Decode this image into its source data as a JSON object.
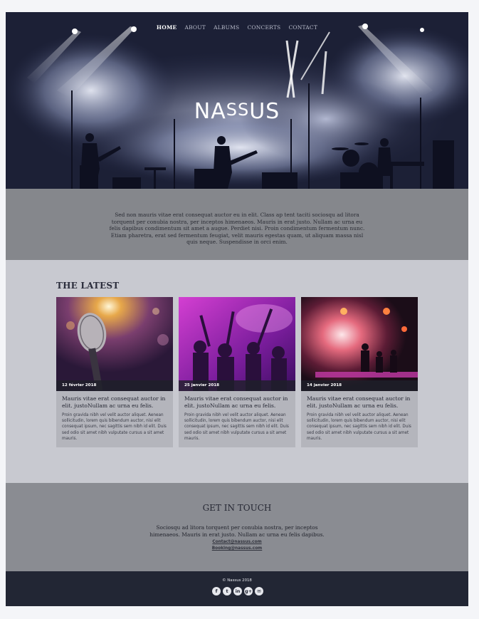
{
  "nav": {
    "items": [
      {
        "label": "HOME"
      },
      {
        "label": "ABOUT"
      },
      {
        "label": "ALBUMS"
      },
      {
        "label": "CONCERTS"
      },
      {
        "label": "CONTACT"
      }
    ]
  },
  "hero": {
    "logo_part1": "NA",
    "logo_part2": "SS",
    "logo_part3": "US",
    "text": "Sed non mauris vitae erat consequat auctor eu in elit. Class ap tent taciti sociosqu ad litora torquent per conubia nostra, per inceptos himenaeos. Mauris in erat justo. Nullam ac urna eu felis dapibus condimentum sit amet a augue. Perdiet nisi. Proin condimentum fermentum nunc. Etiam pharetra, erat sed fermentum feugiat, velit mauris egestas quam, ut aliquam massa nisl quis neque. Suspendisse in orci enim."
  },
  "latest": {
    "title": "THE LATEST",
    "cards": [
      {
        "date": "12 février 2018",
        "title": "Mauris vitae erat consequat auctor in elit. justoNullam ac urna eu felis.",
        "body": "Proin gravida nibh vel velit auctor aliquet. Aenean sollicitudin, lorem quis bibendum auctor, nisi elit consequat ipsum, nec sagittis sem nibh id elit. Duis sed odio sit amet nibh vulputate cursus a sit amet mauris."
      },
      {
        "date": "25 janvier 2018",
        "title": "Mauris vitae erat consequat auctor in elit. justoNullam ac urna eu felis.",
        "body": "Proin gravida nibh vel velit auctor aliquet. Aenean sollicitudin, lorem quis bibendum auctor, nisi elit consequat ipsum, nec sagittis sem nibh id elit. Duis sed odio sit amet nibh vulputate cursus a sit amet mauris."
      },
      {
        "date": "14 janvier 2018",
        "title": "Mauris vitae erat consequat auctor in elit. justoNullam ac urna eu felis.",
        "body": "Proin gravida nibh vel velit auctor aliquet. Aenean sollicitudin, lorem quis bibendum auctor, nisi elit consequat ipsum, nec sagittis sem nibh id elit. Duis sed odio sit amet nibh vulputate cursus a sit amet mauris."
      }
    ]
  },
  "contact": {
    "title": "GET IN TOUCH",
    "text": "Sociosqu ad litora torquent per conubia nostra, per inceptos himenaeos. Mauris in erat justo. Nullam ac urna eu felis dapibus.",
    "email_contact": "Contact@nassus.com",
    "email_booking": "Booking@nassus.com"
  },
  "footer": {
    "copyright": "© Nassus 2018",
    "socials": [
      {
        "icon": "facebook-icon",
        "glyph": "f"
      },
      {
        "icon": "twitter-icon",
        "glyph": "t"
      },
      {
        "icon": "linkedin-icon",
        "glyph": "in"
      },
      {
        "icon": "googleplus-icon",
        "glyph": "g+"
      },
      {
        "icon": "email-icon",
        "glyph": "✉"
      }
    ]
  },
  "colors": {
    "hero_dark": "#1d2036",
    "hero_grey": "#85878c",
    "latest_bg": "#c8c9d0",
    "contact_bg": "#8a8c92",
    "footer_bg": "#222634"
  }
}
